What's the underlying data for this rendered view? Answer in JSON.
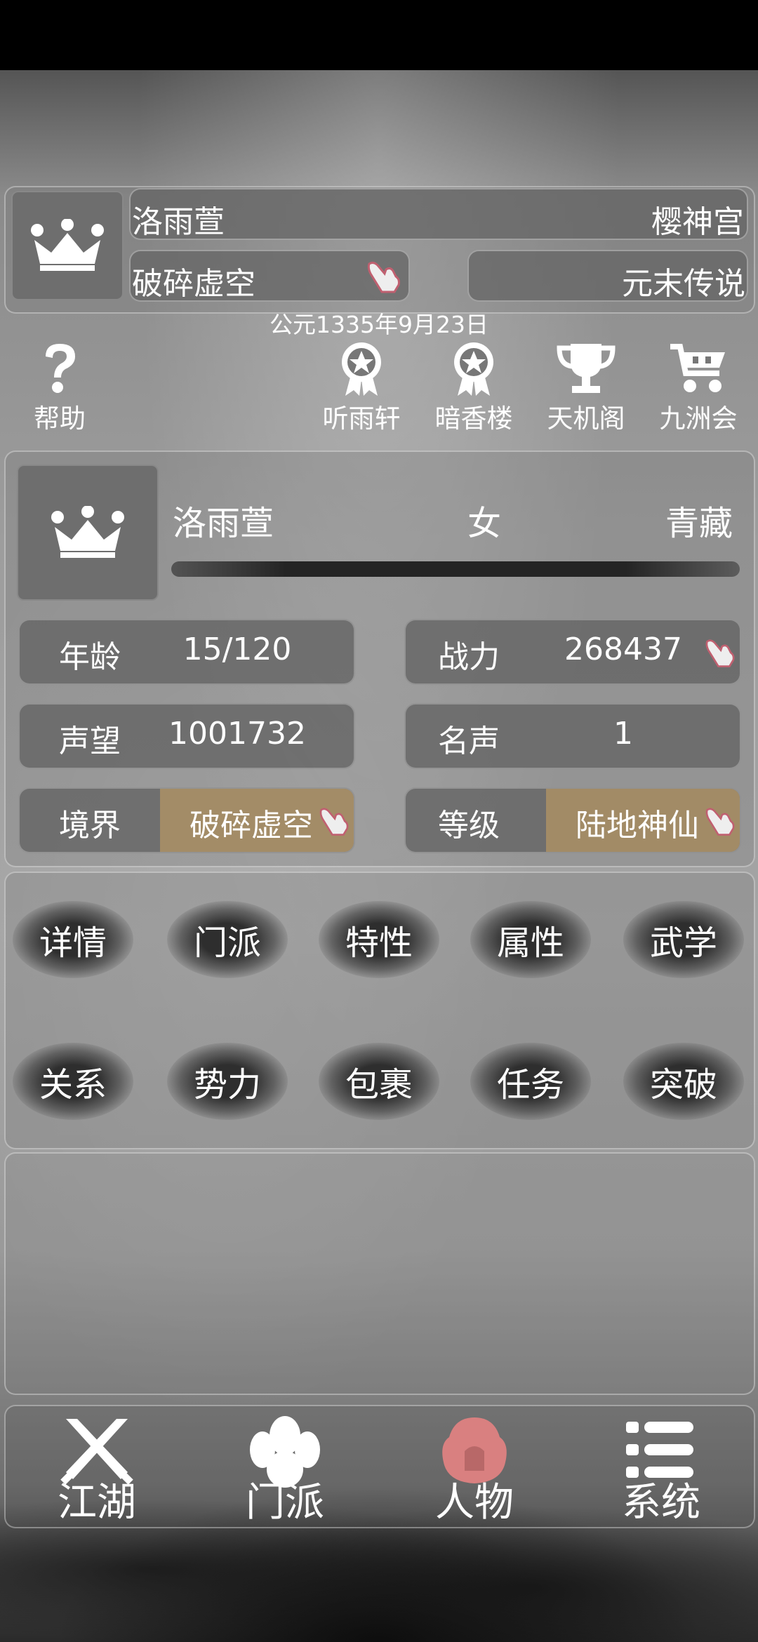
{
  "header": {
    "name": "洛雨萱",
    "sect": "樱神宫",
    "realm": "破碎虚空",
    "era_title": "元末传说",
    "date": "公元1335年9月23日"
  },
  "top_icons": {
    "help": "帮助",
    "rank1": "听雨轩",
    "rank2": "暗香楼",
    "rank3": "天机阁",
    "rank4": "九洲会"
  },
  "profile": {
    "name": "洛雨萱",
    "gender": "女",
    "region": "青藏"
  },
  "stats": {
    "age_label": "年龄",
    "age_value": "15/120",
    "power_label": "战力",
    "power_value": "268437",
    "prestige_label": "声望",
    "prestige_value": "1001732",
    "fame_label": "名声",
    "fame_value": "1",
    "realm_label": "境界",
    "realm_value": "破碎虚空",
    "level_label": "等级",
    "level_value": "陆地神仙"
  },
  "menu": {
    "row1": [
      "详情",
      "门派",
      "特性",
      "属性",
      "武学"
    ],
    "row2": [
      "关系",
      "势力",
      "包裹",
      "任务",
      "突破"
    ]
  },
  "bottom_nav": {
    "jianghu": "江湖",
    "menpai": "门派",
    "renwu": "人物",
    "xitong": "系统",
    "active": "renwu"
  },
  "colors": {
    "accent_active": "#d98080",
    "gold_highlight": "#b4966a"
  }
}
